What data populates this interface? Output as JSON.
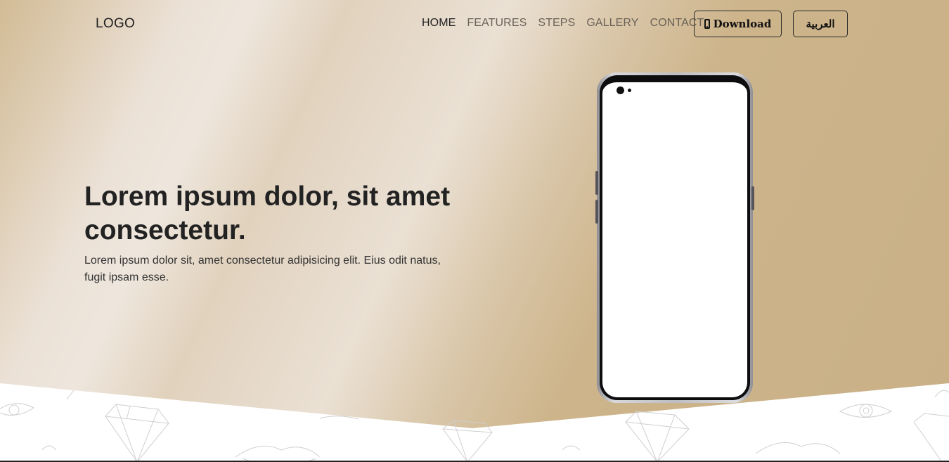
{
  "header": {
    "logo": "LOGO",
    "nav": [
      {
        "label": "HOME",
        "active": true
      },
      {
        "label": "FEATURES",
        "active": false
      },
      {
        "label": "STEPS",
        "active": false
      },
      {
        "label": "GALLERY",
        "active": false
      },
      {
        "label": "CONTACT",
        "active": false
      }
    ],
    "download_label": "Download",
    "download_icon": "mobile-phone-icon",
    "language_label": "العربية"
  },
  "hero": {
    "headline": "Lorem ipsum dolor, sit amet consectetur.",
    "subtext": "Lorem ipsum dolor sit, amet consectetur adipisicing elit. Eius odit natus, fugit ipsam esse."
  },
  "colors": {
    "hero_gold": "#c9b086",
    "hero_light": "#eee6dd",
    "text_dark": "#222222",
    "nav_muted": "#6a6258"
  }
}
